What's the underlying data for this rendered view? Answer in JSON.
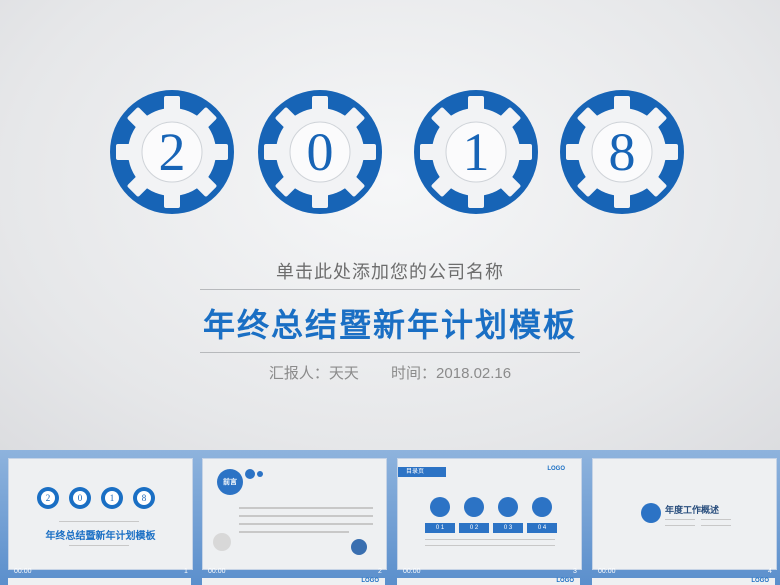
{
  "hero": {
    "digits": [
      "2",
      "0",
      "1",
      "8"
    ],
    "subtitle": "单击此处添加您的公司名称",
    "title": "年终总结暨新年计划模板",
    "reporter": "汇报人：天天",
    "time": "时间：2018.02.16"
  },
  "colors": {
    "accent": "#1a6fc4",
    "gear": "#1764b6",
    "strip": "#6b9bd2"
  },
  "thumbnails": [
    {
      "index": "1",
      "time": "00:00",
      "title": "年终总结暨新年计划模板",
      "digits": [
        "2",
        "0",
        "1",
        "8"
      ]
    },
    {
      "index": "2",
      "time": "00:00",
      "title": "前言"
    },
    {
      "index": "3",
      "time": "00:00",
      "title": "目录页",
      "logo": "LOGO",
      "items": [
        "0 1",
        "0 2",
        "0 3",
        "0 4"
      ]
    },
    {
      "index": "4",
      "time": "00:00",
      "title": "年度工作概述"
    }
  ],
  "bottom_row": {
    "logo": "LOGO"
  }
}
